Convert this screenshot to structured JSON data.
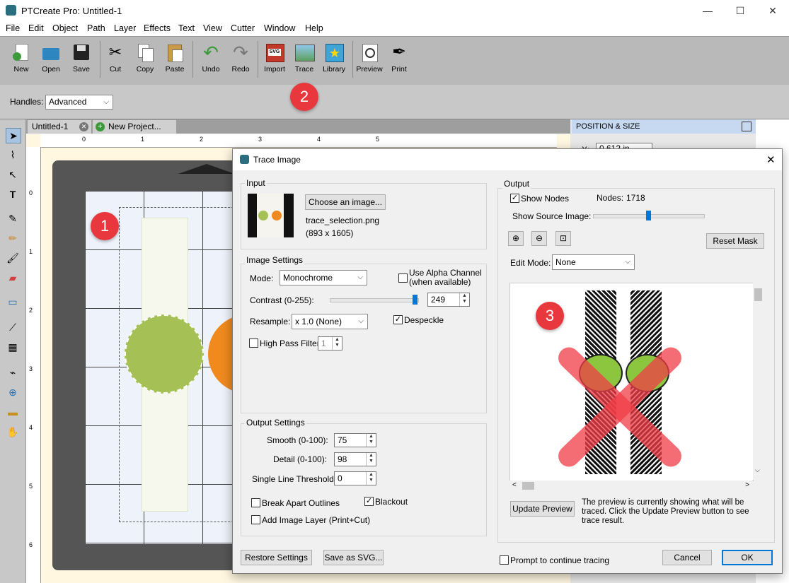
{
  "app": {
    "title": "PTCreate Pro: Untitled-1"
  },
  "window_controls": {
    "minimize": "—",
    "maximize": "☐",
    "close": "✕"
  },
  "menu": [
    "File",
    "Edit",
    "Object",
    "Path",
    "Layer",
    "Effects",
    "Text",
    "View",
    "Cutter",
    "Window",
    "Help"
  ],
  "toolbar": {
    "new": "New",
    "open": "Open",
    "save": "Save",
    "cut": "Cut",
    "copy": "Copy",
    "paste": "Paste",
    "undo": "Undo",
    "redo": "Redo",
    "import": "Import",
    "trace": "Trace",
    "library": "Library",
    "preview": "Preview",
    "print": "Print"
  },
  "handles": {
    "label": "Handles:",
    "value": "Advanced"
  },
  "tabs": {
    "doc": "Untitled-1",
    "new_project": "New Project..."
  },
  "ruler": {
    "h": [
      "0",
      "1",
      "2",
      "3",
      "4",
      "5"
    ],
    "v": [
      "0",
      "1",
      "2",
      "3",
      "4",
      "5",
      "6"
    ]
  },
  "panel": {
    "title": "POSITION & SIZE",
    "x_label": "X:",
    "x_value": "0.612 in"
  },
  "badges": {
    "b1": "1",
    "b2": "2",
    "b3": "3"
  },
  "dialog": {
    "title": "Trace Image",
    "input": {
      "group": "Input",
      "choose": "Choose an image...",
      "filename": "trace_selection.png",
      "dims": "(893 x 1605)"
    },
    "image_settings": {
      "group": "Image Settings",
      "mode_label": "Mode:",
      "mode_value": "Monochrome",
      "alpha": "Use Alpha Channel\n(when available)",
      "contrast_label": "Contrast (0-255):",
      "contrast_value": "249",
      "contrast_fraction": 0.976,
      "resample_label": "Resample:",
      "resample_value": "x 1.0 (None)",
      "despeckle": "Despeckle",
      "highpass": "High Pass Filter",
      "highpass_value": "1"
    },
    "output_settings": {
      "group": "Output Settings",
      "smooth_label": "Smooth (0-100):",
      "smooth_value": "75",
      "detail_label": "Detail (0-100):",
      "detail_value": "98",
      "threshold_label": "Single Line Threshold:",
      "threshold_value": "0",
      "break_apart": "Break Apart Outlines",
      "blackout": "Blackout",
      "add_layer": "Add Image Layer (Print+Cut)"
    },
    "output": {
      "group": "Output",
      "show_nodes": "Show Nodes",
      "nodes_label": "Nodes:",
      "nodes_value": "1718",
      "show_source": "Show Source Image:",
      "reset_mask": "Reset Mask",
      "edit_mode_label": "Edit Mode:",
      "edit_mode_value": "None",
      "update_preview": "Update Preview",
      "note": "The preview is currently showing what will be traced. Click the Update Preview button to see trace result."
    },
    "buttons": {
      "restore": "Restore Settings",
      "save_svg": "Save as SVG...",
      "prompt": "Prompt to continue tracing",
      "cancel": "Cancel",
      "ok": "OK"
    }
  }
}
